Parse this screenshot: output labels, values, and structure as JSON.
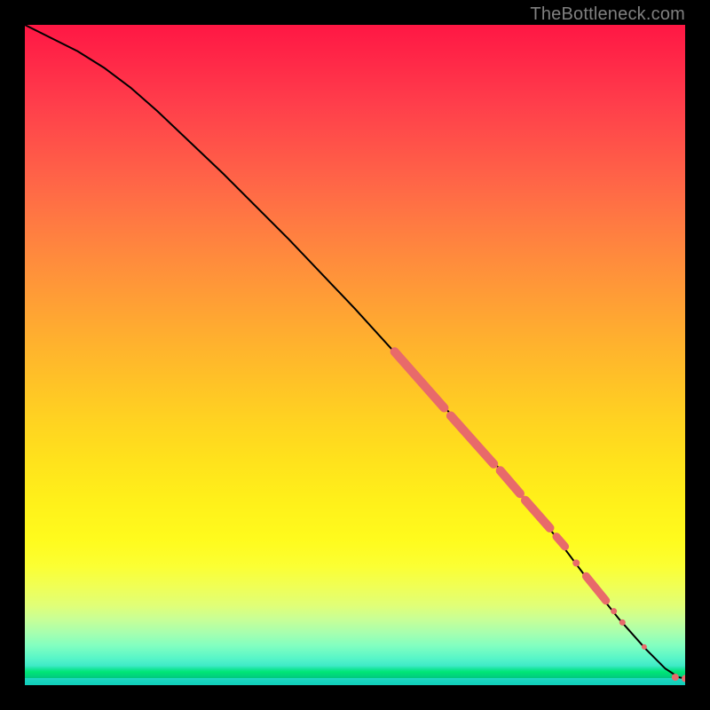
{
  "watermark": "TheBottleneck.com",
  "chart_data": {
    "type": "line",
    "title": "",
    "xlabel": "",
    "ylabel": "",
    "xlim": [
      0,
      100
    ],
    "ylim": [
      0,
      100
    ],
    "grid": false,
    "legend": false,
    "series": [
      {
        "name": "curve",
        "x": [
          0,
          4,
          8,
          12,
          16,
          20,
          30,
          40,
          50,
          60,
          70,
          80,
          86,
          90,
          94,
          97,
          99,
          100
        ],
        "y": [
          100,
          98,
          96,
          93.5,
          90.5,
          87,
          77.5,
          67.5,
          57,
          46,
          35,
          23,
          15,
          10,
          5.5,
          2.5,
          1.2,
          1
        ]
      }
    ],
    "markers": [
      {
        "kind": "segment",
        "x0": 56,
        "y0": 50.5,
        "x1": 63.5,
        "y1": 42,
        "r": 5
      },
      {
        "kind": "segment",
        "x0": 64.5,
        "y0": 40.8,
        "x1": 71,
        "y1": 33.5,
        "r": 5
      },
      {
        "kind": "segment",
        "x0": 72,
        "y0": 32.5,
        "x1": 75,
        "y1": 29,
        "r": 5
      },
      {
        "kind": "segment",
        "x0": 75.8,
        "y0": 28,
        "x1": 79.5,
        "y1": 23.8,
        "r": 5
      },
      {
        "kind": "segment",
        "x0": 80.5,
        "y0": 22.5,
        "x1": 81.8,
        "y1": 21,
        "r": 4.5
      },
      {
        "kind": "dot",
        "x": 83.5,
        "y": 18.5,
        "r": 4
      },
      {
        "kind": "segment",
        "x0": 85,
        "y0": 16.5,
        "x1": 88,
        "y1": 12.8,
        "r": 4.5
      },
      {
        "kind": "dot",
        "x": 89.2,
        "y": 11.2,
        "r": 3.5
      },
      {
        "kind": "dot",
        "x": 90.5,
        "y": 9.5,
        "r": 3.5
      },
      {
        "kind": "dot",
        "x": 93.8,
        "y": 5.8,
        "r": 3
      },
      {
        "kind": "dot",
        "x": 98.5,
        "y": 1.2,
        "r": 4
      },
      {
        "kind": "dot",
        "x": 100,
        "y": 1.0,
        "r": 4
      }
    ],
    "colors": {
      "curve": "#000000",
      "marker": "#e86a6a",
      "gradient_top": "#ff1744",
      "gradient_bottom": "#0fceba",
      "background_frame": "#000000"
    }
  }
}
